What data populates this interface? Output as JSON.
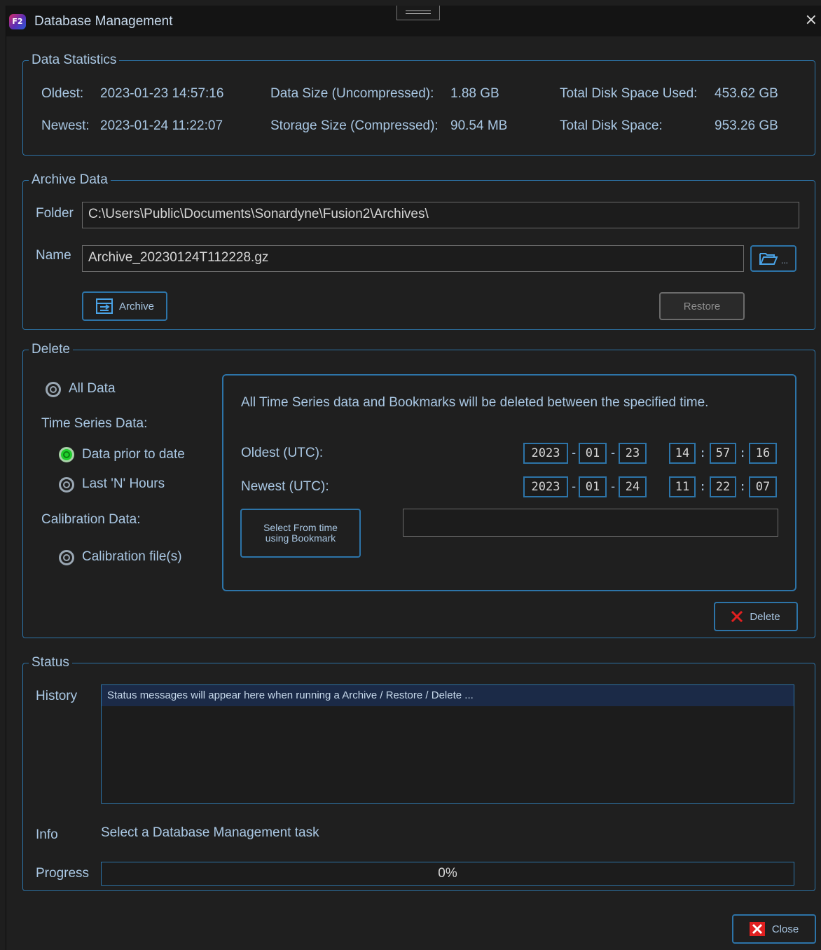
{
  "window": {
    "title": "Database Management",
    "app_icon_text": "F2",
    "close_glyph": "×"
  },
  "stats": {
    "title": "Data Statistics",
    "oldest_label": "Oldest:",
    "oldest_value": "2023-01-23 14:57:16",
    "newest_label": "Newest:",
    "newest_value": "2023-01-24 11:22:07",
    "data_size_label": "Data Size (Uncompressed):",
    "data_size_value": "1.88 GB",
    "storage_size_label": "Storage Size (Compressed):",
    "storage_size_value": "90.54 MB",
    "disk_used_label": "Total Disk Space Used:",
    "disk_used_value": "453.62 GB",
    "disk_total_label": "Total Disk Space:",
    "disk_total_value": "953.26 GB"
  },
  "archive": {
    "title": "Archive Data",
    "folder_label": "Folder",
    "folder_value": "C:\\Users\\Public\\Documents\\Sonardyne\\Fusion2\\Archives\\",
    "name_label": "Name",
    "name_value": "Archive_20230124T112228.gz",
    "browse_suffix": "...",
    "archive_button": "Archive",
    "restore_button": "Restore"
  },
  "delete": {
    "title": "Delete",
    "all_data": "All Data",
    "time_series_label": "Time Series Data:",
    "prior_to_date": "Data prior to date",
    "last_n_hours": "Last 'N' Hours",
    "calibration_label": "Calibration Data:",
    "calibration_files": "Calibration file(s)",
    "description": "All Time Series data and Bookmarks will be deleted between the specified time.",
    "oldest_label": "Oldest (UTC):",
    "newest_label": "Newest (UTC):",
    "oldest": {
      "year": "2023",
      "month": "01",
      "day": "23",
      "hour": "14",
      "minute": "57",
      "second": "16"
    },
    "newest": {
      "year": "2023",
      "month": "01",
      "day": "24",
      "hour": "11",
      "minute": "22",
      "second": "07"
    },
    "date_sep": "-",
    "time_sep": ":",
    "bookmark_button_line1": "Select From time",
    "bookmark_button_line2": "using Bookmark",
    "bookmark_value": "",
    "delete_button": "Delete",
    "selected_option": "Data prior to date"
  },
  "status": {
    "title": "Status",
    "history_label": "History",
    "history_message": "Status messages will appear here when running a Archive / Restore / Delete ...",
    "info_label": "Info",
    "info_value": "Select a Database Management task",
    "progress_label": "Progress",
    "progress_text": "0%",
    "progress_value": 0
  },
  "footer": {
    "close_button": "Close"
  },
  "colors": {
    "accent": "#2d74a8",
    "text": "#a9c7e3",
    "radio_checked": "#1fcf2c",
    "delete_x": "#e02020"
  }
}
